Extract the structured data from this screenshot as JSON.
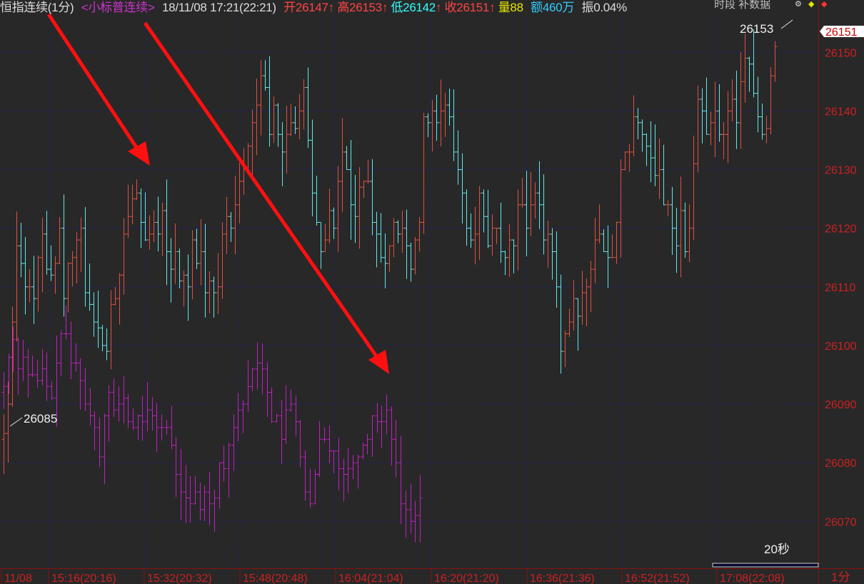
{
  "header": {
    "title": "恒指连续(1分)",
    "indicator": "<小标普连续>",
    "datetime": "18/11/08 17:21(22:21)",
    "open_label": "开",
    "open_value": "26147",
    "high_label": "高",
    "high_value": "26153",
    "low_label": "低",
    "low_value": "26142",
    "close_label": "收",
    "close_value": "26151",
    "volume_label": "量",
    "volume_value": "88",
    "amount_label": "额",
    "amount_value": "460万",
    "amp_label": "振",
    "amp_value": "0.04%",
    "up_arrow": "↑",
    "right_text": "时段 补数据",
    "colors": {
      "title": "#dcdcdc",
      "indicator": "#cc33cc",
      "datetime": "#dcdcdc",
      "up": "#ff4444",
      "low": "#33ffff",
      "volume": "#e6e600",
      "amount": "#33ccff",
      "amp": "#dcdcdc"
    }
  },
  "annotations": {
    "high_label": "26153",
    "low_label": "26085",
    "current_price_tag": "26151",
    "interval_badge": "20秒",
    "period_button": "1分"
  },
  "colors": {
    "background": "#282828",
    "grid": "#1e1e6e",
    "up_bar": "#e05040",
    "down_bar": "#60e8e8",
    "overlay_bar": "#c21fc2",
    "axis_text": "#cc2020",
    "arrow": "#ff1010"
  },
  "chart_data": {
    "type": "ohlc",
    "y_axis": {
      "ticks": [
        26070,
        26080,
        26090,
        26100,
        26110,
        26120,
        26130,
        26140,
        26150
      ],
      "range": [
        26062,
        26156
      ]
    },
    "x_axis": {
      "labels": [
        "11/08",
        "15:16(20:16)",
        "15:32(20:32)",
        "15:48(20:48)",
        "16:04(21:04)",
        "16:20(21:20)",
        "16:36(21:36)",
        "16:52(21:52)",
        "17:08(22:08)"
      ]
    },
    "series_main_close": [
      26085,
      26090,
      26104,
      26117,
      26114,
      26110,
      26110,
      26108,
      26115,
      26119,
      26113,
      26112,
      26114,
      26120,
      26108,
      26114,
      26115,
      26118,
      26120,
      26109,
      26107,
      26104,
      26103,
      26100,
      26099,
      26107,
      26108,
      26112,
      26119,
      26122,
      26125,
      26126,
      26121,
      26118,
      26119,
      26121,
      26119,
      26123,
      26116,
      26113,
      26116,
      26111,
      26112,
      26110,
      26118,
      26114,
      26116,
      26109,
      26111,
      26109,
      26110,
      26119,
      26122,
      26120,
      26124,
      26128,
      26130,
      26134,
      26138,
      26141,
      26146,
      26144,
      26136,
      26141,
      26136,
      26133,
      26136,
      26138,
      26137,
      26140,
      26144,
      26135,
      26126,
      26121,
      26116,
      26118,
      26123,
      26120,
      26128,
      26133,
      26130,
      26124,
      26122,
      26127,
      26128,
      26128,
      26121,
      26119,
      26115,
      26114,
      26117,
      26121,
      26119,
      26120,
      26117,
      26113,
      26118,
      26121,
      26139,
      26138,
      26140,
      26138,
      26140,
      26141,
      26139,
      26133,
      26130,
      26126,
      26120,
      26118,
      26119,
      26126,
      26122,
      26117,
      26120,
      26120,
      26116,
      26115,
      26118,
      26117,
      26124,
      26124,
      26120,
      26124,
      26126,
      26124,
      26118,
      26119,
      26116,
      26110,
      26099,
      26102,
      26104,
      26108,
      26105,
      26109,
      26110,
      26113,
      26118,
      26119,
      26116,
      26115,
      26115,
      26121,
      26130,
      26133,
      26133,
      26139,
      26138,
      26136,
      26134,
      26132,
      26129,
      26130,
      26124,
      26124,
      26120,
      26117,
      26123,
      26116,
      26120,
      26131,
      26142,
      26140,
      26136,
      26138,
      26140,
      26136,
      26136,
      26140,
      26142,
      26138,
      26145,
      26149,
      26148,
      26143,
      26139,
      26136,
      26137,
      26146,
      26151
    ],
    "series_overlay_close": [
      26093,
      26098,
      26101,
      26096,
      26098,
      26095,
      26095,
      26094,
      26096,
      26093,
      26091,
      26097,
      26102,
      26102,
      26097,
      26097,
      26094,
      26090,
      26088,
      26086,
      26081,
      26088,
      26092,
      26089,
      26090,
      26091,
      26087,
      26086,
      26088,
      26087,
      26089,
      26088,
      26086,
      26086,
      26086,
      26083,
      26078,
      26075,
      26074,
      26073,
      26075,
      26072,
      26075,
      26073,
      26074,
      26080,
      26079,
      26083,
      26086,
      26089,
      26090,
      26093,
      26096,
      26097,
      26096,
      26092,
      26087,
      26088,
      26084,
      26089,
      26090,
      26087,
      26081,
      26075,
      26073,
      26078,
      26084,
      26084,
      26082,
      26082,
      26079,
      26078,
      26079,
      26080,
      26081,
      26083,
      26084,
      26088,
      26087,
      26087,
      26089,
      26084,
      26080,
      26073,
      26072,
      26070,
      26071,
      26074
    ]
  }
}
